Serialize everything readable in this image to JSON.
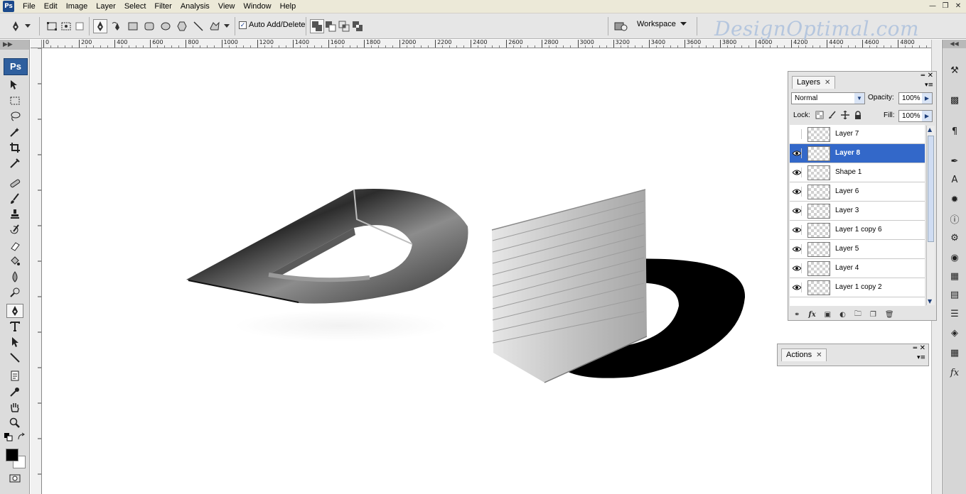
{
  "app": {
    "badge": "Ps",
    "logo": "Ps"
  },
  "menu": [
    "File",
    "Edit",
    "Image",
    "Layer",
    "Select",
    "Filter",
    "Analysis",
    "View",
    "Window",
    "Help"
  ],
  "window_controls": [
    "minimize-icon",
    "restore-icon",
    "close-icon"
  ],
  "options_bar": {
    "auto_add_delete": {
      "label": "Auto Add/Delete",
      "checked": true
    },
    "workspace_label": "Workspace"
  },
  "watermark": "DesignOptimal.com",
  "ruler": {
    "top_ticks": [
      "0",
      "200",
      "400",
      "600",
      "800",
      "1000",
      "1200",
      "1400",
      "1600",
      "1800",
      "2000",
      "2200",
      "2400",
      "2600",
      "2800",
      "3000",
      "3200",
      "3400",
      "3600",
      "3800",
      "4000",
      "4200",
      "4400",
      "4600",
      "4800"
    ]
  },
  "layers_panel": {
    "tab": "Layers",
    "blend_mode": "Normal",
    "opacity_label": "Opacity:",
    "opacity_value": "100%",
    "lock_label": "Lock:",
    "fill_label": "Fill:",
    "fill_value": "100%",
    "layers": [
      {
        "name": "Layer 7",
        "visible": false,
        "selected": false
      },
      {
        "name": "Layer 8",
        "visible": true,
        "selected": true
      },
      {
        "name": "Shape 1",
        "visible": true,
        "selected": false
      },
      {
        "name": "Layer 6",
        "visible": true,
        "selected": false
      },
      {
        "name": "Layer 3",
        "visible": true,
        "selected": false
      },
      {
        "name": "Layer 1 copy 6",
        "visible": true,
        "selected": false
      },
      {
        "name": "Layer 5",
        "visible": true,
        "selected": false
      },
      {
        "name": "Layer 4",
        "visible": true,
        "selected": false
      },
      {
        "name": "Layer 1 copy 2",
        "visible": true,
        "selected": false
      }
    ]
  },
  "actions_panel": {
    "tab": "Actions"
  },
  "colors": {
    "selection": "#3368c9",
    "foreground": "#000000",
    "background": "#ffffff"
  }
}
